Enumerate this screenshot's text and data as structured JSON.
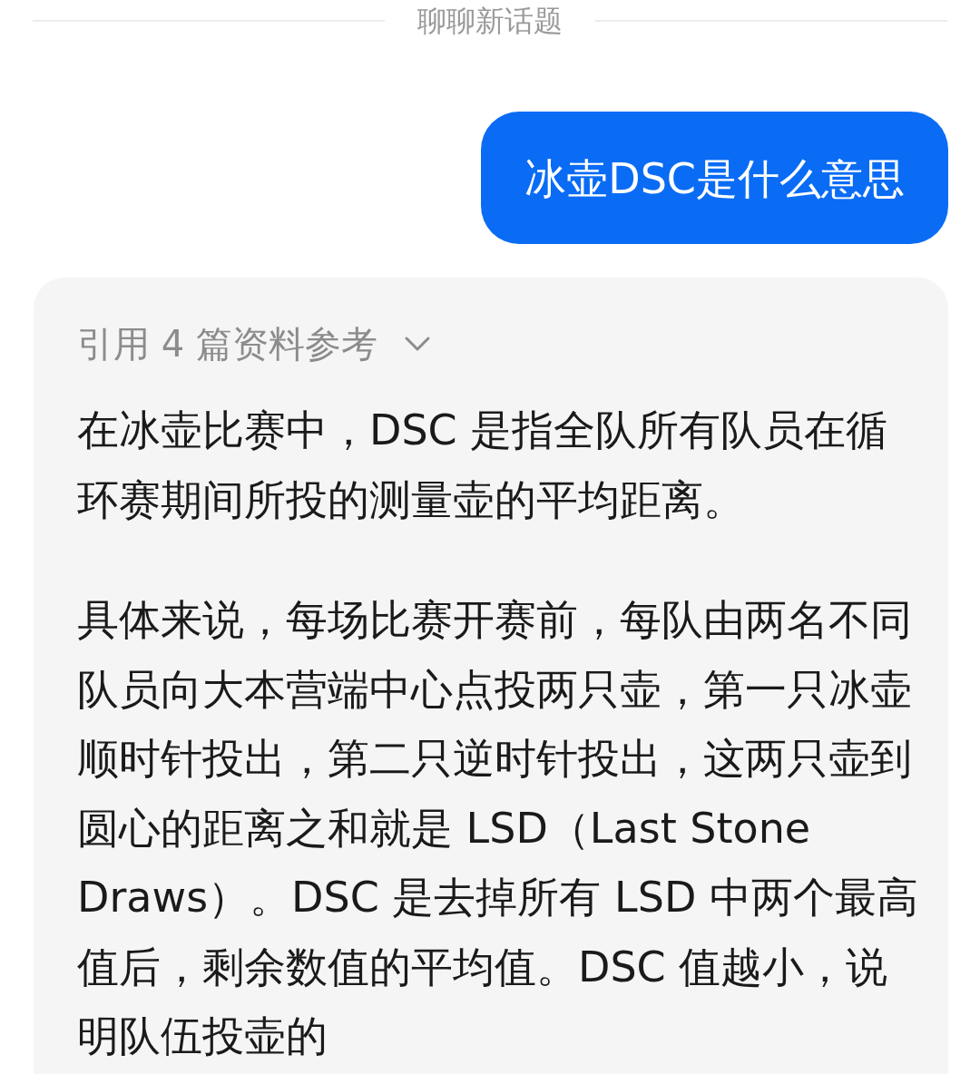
{
  "divider": {
    "label": "聊聊新话题"
  },
  "messages": [
    {
      "kind": "user",
      "text": "冰壶DSC是什么意思"
    },
    {
      "kind": "assistant",
      "citation": "引用 4 篇资料参考",
      "expanded": false,
      "paragraphs": [
        "在冰壶比赛中，DSC 是指全队所有队员在循环赛期间所投的测量壶的平均距离。",
        "具体来说，每场比赛开赛前，每队由两名不同队员向大本营端中心点投两只壶，第一只冰壶顺时针投出，第二只逆时针投出，这两只壶到圆心的距离之和就是 LSD（Last Stone Draws）。DSC 是去掉所有 LSD 中两个最高值后，剩余数值的平均值。DSC 值越小，说明队伍投壶的"
      ]
    }
  ]
}
